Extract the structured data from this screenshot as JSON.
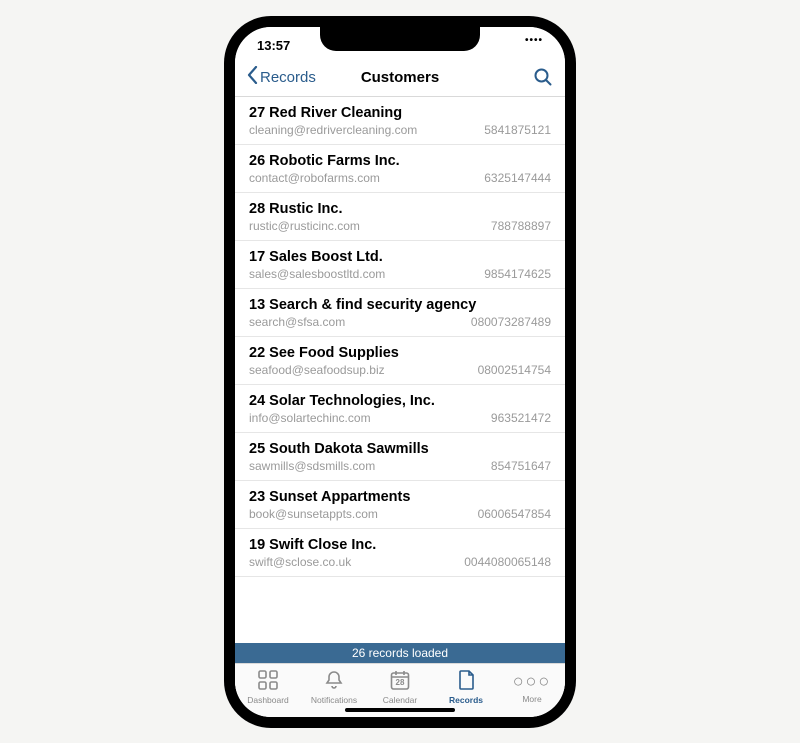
{
  "statusbar": {
    "time": "13:57"
  },
  "navbar": {
    "back_label": "Records",
    "title": "Customers"
  },
  "customers": [
    {
      "name": "27 Red River Cleaning",
      "email": "cleaning@redrivercleaning.com",
      "phone": "5841875121"
    },
    {
      "name": "26 Robotic Farms Inc.",
      "email": "contact@robofarms.com",
      "phone": "6325147444"
    },
    {
      "name": "28 Rustic Inc.",
      "email": "rustic@rusticinc.com",
      "phone": "788788897"
    },
    {
      "name": "17 Sales Boost Ltd.",
      "email": "sales@salesboostltd.com",
      "phone": "9854174625"
    },
    {
      "name": "13 Search & find security agency",
      "email": "search@sfsa.com",
      "phone": "080073287489"
    },
    {
      "name": "22 See Food Supplies",
      "email": "seafood@seafoodsup.biz",
      "phone": "08002514754"
    },
    {
      "name": "24 Solar Technologies, Inc.",
      "email": "info@solartechinc.com",
      "phone": "963521472"
    },
    {
      "name": "25 South Dakota Sawmills",
      "email": "sawmills@sdsmills.com",
      "phone": "854751647"
    },
    {
      "name": "23 Sunset Appartments",
      "email": "book@sunsetappts.com",
      "phone": "06006547854"
    },
    {
      "name": "19 Swift Close Inc.",
      "email": "swift@sclose.co.uk",
      "phone": "0044080065148"
    }
  ],
  "status": {
    "text": "26 records loaded"
  },
  "tabs": {
    "dashboard": "Dashboard",
    "notifications": "Notifications",
    "calendar": "Calendar",
    "calendar_day": "28",
    "records": "Records",
    "more": "More"
  }
}
